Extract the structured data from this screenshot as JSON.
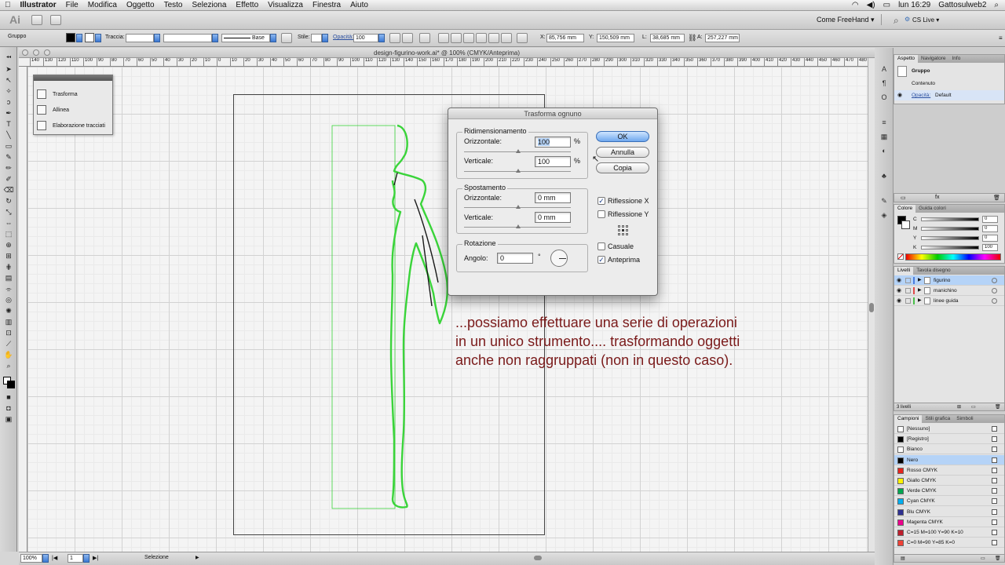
{
  "menubar": {
    "apple": "",
    "app_name": "Illustrator",
    "items": [
      "File",
      "Modifica",
      "Oggetto",
      "Testo",
      "Seleziona",
      "Effetto",
      "Visualizza",
      "Finestra",
      "Aiuto"
    ],
    "clock": "lun 16:29",
    "user": "Gattosulweb2"
  },
  "appbar": {
    "logo": "Ai",
    "workspace": "Come FreeHand ▾",
    "cs_live": "CS Live ▾"
  },
  "control_bar": {
    "selection_type": "Gruppo",
    "stroke_label": "Traccia:",
    "brush_label": "Base",
    "style_label": "Stile:",
    "opacity_label": "Opacità:",
    "opacity_value": "100",
    "x_label": "X:",
    "x_value": "85,756 mm",
    "y_label": "Y:",
    "y_value": "150,509 mm",
    "w_label": "L:",
    "w_value": "38,685 mm",
    "h_label": "A:",
    "h_value": "257,227 mm"
  },
  "document": {
    "tab_title": "design-figurino-work.ai* @ 100% (CMYK/Anteprima)",
    "ruler_ticks": [
      "140",
      "130",
      "120",
      "110",
      "100",
      "90",
      "80",
      "70",
      "60",
      "50",
      "40",
      "30",
      "20",
      "10",
      "0",
      "10",
      "20",
      "30",
      "40",
      "50",
      "60",
      "70",
      "80",
      "90",
      "100",
      "110",
      "120",
      "130",
      "140",
      "150",
      "160",
      "170",
      "180",
      "190",
      "200",
      "210",
      "220",
      "230",
      "240",
      "250",
      "260",
      "270",
      "280",
      "290",
      "300",
      "310",
      "320",
      "330",
      "340",
      "350",
      "360",
      "370",
      "380",
      "390",
      "400",
      "410",
      "420",
      "430",
      "440",
      "450",
      "460",
      "470",
      "480",
      "490",
      "500",
      "510"
    ]
  },
  "float_panel": {
    "items": [
      "Trasforma",
      "Allinea",
      "Elaborazione tracciati"
    ]
  },
  "dialog": {
    "title": "Trasforma ognuno",
    "scale_group": "Ridimensionamento",
    "scale_h_label": "Orizzontale:",
    "scale_h_value": "100",
    "scale_v_label": "Verticale:",
    "scale_v_value": "100",
    "percent": "%",
    "move_group": "Spostamento",
    "move_h_label": "Orizzontale:",
    "move_h_value": "0 mm",
    "move_v_label": "Verticale:",
    "move_v_value": "0 mm",
    "rotate_group": "Rotazione",
    "angle_label": "Angolo:",
    "angle_value": "0",
    "degree": "°",
    "ok": "OK",
    "cancel": "Annulla",
    "copy": "Copia",
    "reflect_x": "Riflessione X",
    "reflect_x_checked": true,
    "reflect_y": "Riflessione Y",
    "reflect_y_checked": false,
    "random": "Casuale",
    "random_checked": false,
    "preview": "Anteprima",
    "preview_checked": true
  },
  "caption": {
    "line1": "...possiamo effettuare una serie di operazioni",
    "line2": "in un unico strumento.... trasformando oggetti",
    "line3": "anche non raggruppati (non in questo caso)."
  },
  "status_bar": {
    "zoom": "100%",
    "page": "1",
    "status": "Selezione"
  },
  "appearance_panel": {
    "tabs": [
      "Aspetto",
      "Navigatore",
      "Info"
    ],
    "group": "Gruppo",
    "content": "Contenuto",
    "opacity_label": "Opacità:",
    "opacity_value": "Default"
  },
  "color_panel": {
    "tabs": [
      "Colore",
      "Guida colori"
    ],
    "channels": [
      "C",
      "M",
      "Y",
      "K"
    ],
    "values": [
      "0",
      "0",
      "0",
      "100"
    ],
    "k_fill": 1.0
  },
  "layers_panel": {
    "tabs": [
      "Livelli",
      "Tavola disegno"
    ],
    "layers": [
      {
        "name": "figurino",
        "color": "#4a7de0",
        "selected": true
      },
      {
        "name": "manichino",
        "color": "#e04a4a",
        "selected": false
      },
      {
        "name": "linee guida",
        "color": "#4ac04a",
        "selected": false
      }
    ],
    "footer": "3 livelli"
  },
  "swatches_panel": {
    "tabs": [
      "Campioni",
      "Stili grafica",
      "Simboli"
    ],
    "items": [
      {
        "name": "[Nessuno]",
        "color": "#ffffff"
      },
      {
        "name": "[Registro]",
        "color": "#000000"
      },
      {
        "name": "Bianco",
        "color": "#ffffff"
      },
      {
        "name": "Nero",
        "color": "#000000"
      },
      {
        "name": "Rosso CMYK",
        "color": "#e6241d"
      },
      {
        "name": "Giallo CMYK",
        "color": "#fff200"
      },
      {
        "name": "Verde CMYK",
        "color": "#00a650"
      },
      {
        "name": "Cyan CMYK",
        "color": "#00aeef"
      },
      {
        "name": "Blu CMYK",
        "color": "#2e3192"
      },
      {
        "name": "Magenta CMYK",
        "color": "#ec008c"
      },
      {
        "name": "C=15 M=100 Y=90 K=10",
        "color": "#be1e2d"
      },
      {
        "name": "C=0 M=90 Y=85 K=0",
        "color": "#ef4136"
      }
    ]
  },
  "colors": {
    "selection_green": "#3ad43a",
    "caption": "#7a1a1a",
    "highlight": "#b5d3f7"
  }
}
